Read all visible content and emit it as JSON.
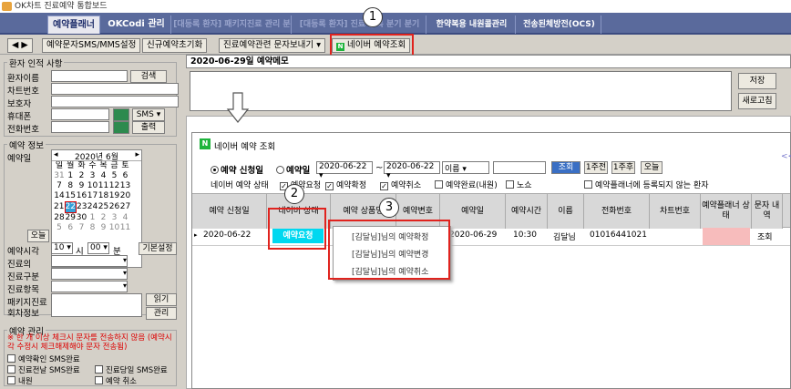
{
  "window": {
    "title": "OK차트 진료예약 통합보드"
  },
  "tabs": [
    {
      "label": "예약플래너"
    },
    {
      "label": "OKCodi 관리"
    },
    {
      "label": "[대등록 환자] 패키지진료 관리 분기"
    },
    {
      "label": "[대등록 환자] 진료 등록 분기 분기"
    },
    {
      "label": "한약복용 내원콜관리"
    },
    {
      "label": "전송된체방전(OCS)"
    }
  ],
  "toolbar": {
    "nav": "◀ ▶",
    "sms_settings": "예약문자SMS/MMS설정",
    "new_reset": "신규예약초기화",
    "send_msg": "진료예약관련 문자보내기",
    "naver": "네이버 예약조회"
  },
  "patient": {
    "section": "환자 인적 사항",
    "name": "환자이름",
    "search": "검색",
    "chart": "차트번호",
    "guardian": "보호자",
    "mobile": "휴대폰",
    "sms": "SMS",
    "phone": "전화번호",
    "print": "출력"
  },
  "reservation": {
    "section": "예약 정보",
    "date_label": "예약일",
    "month": "2020년 6월",
    "weekdays": [
      "일",
      "월",
      "화",
      "수",
      "목",
      "금",
      "토"
    ],
    "weeks": [
      [
        "31",
        "1",
        "2",
        "3",
        "4",
        "5",
        "6"
      ],
      [
        "7",
        "8",
        "9",
        "10",
        "11",
        "12",
        "13"
      ],
      [
        "14",
        "15",
        "16",
        "17",
        "18",
        "19",
        "20"
      ],
      [
        "21",
        "22",
        "23",
        "24",
        "25",
        "26",
        "27"
      ],
      [
        "28",
        "29",
        "30",
        "1",
        "2",
        "3",
        "4"
      ],
      [
        "5",
        "6",
        "7",
        "8",
        "9",
        "10",
        "11"
      ]
    ],
    "today": "오늘",
    "time_label": "예약시각",
    "hour": "10",
    "hour_unit": "시",
    "minute": "00",
    "minute_unit": "분",
    "preset": "기본설정",
    "doctor": "진료의",
    "category": "진료구분",
    "item": "진료항목",
    "package": "패키지진료",
    "session": "회차정보",
    "read": "읽기",
    "manage": "관리"
  },
  "management": {
    "section": "예약 관리",
    "warning": "※ 한 개 이상 체크시 문자를 전송하지 않음 (예약시각 수정시 체크해제해야 문자 전송됨)",
    "checks": [
      "예약확인 SMS완료",
      "진료전날 SMS완료",
      "진료당일 SMS완료",
      "내원",
      "예약 취소"
    ]
  },
  "memo": {
    "header": "2020-06-29일 예약메모",
    "save": "저장",
    "refresh": "새로고침"
  },
  "naver_popup": {
    "title": "네이버 예약 조회",
    "radio_apply": "예약 신청일",
    "radio_date": "예약일",
    "from": "2020-06-22",
    "tilde": "~",
    "to": "2020-06-22",
    "name_sel": "이름",
    "search": "조회",
    "week1": "1주전",
    "week1_next": "1주후",
    "today": "오늘",
    "status_label": "네이버 예약 상태",
    "checks": [
      "예약요청",
      "예약확정",
      "예약취소",
      "예약완료(내원)",
      "노쇼"
    ],
    "planner_check": "예약플래너에 등록되지 않는 환자",
    "link": "<<",
    "columns": [
      "예약 신청일",
      "네이버 상태",
      "예약 상품명",
      "예약변호",
      "예약일",
      "예약시간",
      "이름",
      "전화번호",
      "차트번호",
      "예약플래너 상태",
      "문자 내역"
    ],
    "row": {
      "apply_date": "2020-06-22",
      "status": "예약요청",
      "date": "2020-06-29",
      "time": "10:30",
      "name": "김달님",
      "phone": "01016441021",
      "msg": "조회"
    },
    "menu": [
      "[김달님]님의 예약확정",
      "[김달님]님의 예약변경",
      "[김달님]님의 예약취소"
    ]
  },
  "callouts": [
    "1",
    "2",
    "3"
  ],
  "colors": {
    "tabbar": "#5a6a9c",
    "accent_red": "#e0231e",
    "status_cyan": "#00d8f0",
    "planner_pink": "#f7bcbc"
  }
}
